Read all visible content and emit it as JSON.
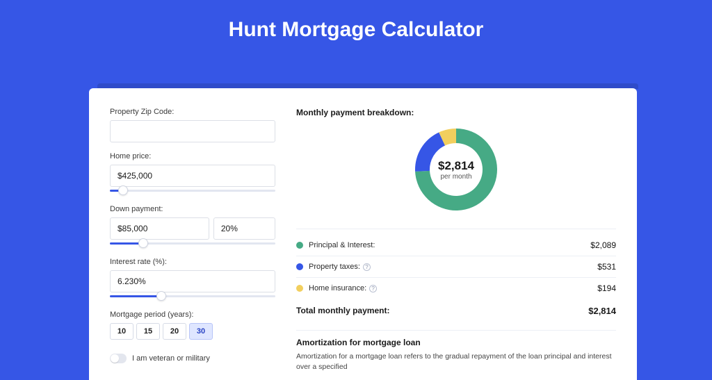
{
  "page": {
    "title": "Hunt Mortgage Calculator"
  },
  "form": {
    "zip": {
      "label": "Property Zip Code:",
      "value": ""
    },
    "homePrice": {
      "label": "Home price:",
      "value": "$425,000",
      "sliderPct": 8
    },
    "downPayment": {
      "label": "Down payment:",
      "valueAmount": "$85,000",
      "valuePct": "20%",
      "sliderPct": 20
    },
    "interestRate": {
      "label": "Interest rate (%):",
      "value": "6.230%",
      "sliderPct": 31
    },
    "mortgagePeriod": {
      "label": "Mortgage period (years):",
      "options": [
        {
          "label": "10",
          "active": false
        },
        {
          "label": "15",
          "active": false
        },
        {
          "label": "20",
          "active": false
        },
        {
          "label": "30",
          "active": true
        }
      ]
    },
    "veteran": {
      "label": "I am veteran or military",
      "enabled": false
    }
  },
  "breakdown": {
    "title": "Monthly payment breakdown:",
    "center": {
      "amount": "$2,814",
      "per": "per month"
    },
    "items": [
      {
        "label": "Principal & Interest:",
        "value": "$2,089",
        "color": "#46aa85",
        "numeric": 2089,
        "help": false
      },
      {
        "label": "Property taxes:",
        "value": "$531",
        "color": "#3656e6",
        "numeric": 531,
        "help": true
      },
      {
        "label": "Home insurance:",
        "value": "$194",
        "color": "#f2cf5e",
        "numeric": 194,
        "help": true
      }
    ],
    "total": {
      "label": "Total monthly payment:",
      "value": "$2,814"
    }
  },
  "amortization": {
    "title": "Amortization for mortgage loan",
    "body": "Amortization for a mortgage loan refers to the gradual repayment of the loan principal and interest over a specified"
  },
  "chart_data": {
    "type": "pie",
    "title": "Monthly payment breakdown",
    "series": [
      {
        "name": "Principal & Interest",
        "value": 2089,
        "color": "#46aa85"
      },
      {
        "name": "Property taxes",
        "value": 531,
        "color": "#3656e6"
      },
      {
        "name": "Home insurance",
        "value": 194,
        "color": "#f2cf5e"
      }
    ],
    "center_label": "$2,814 per month",
    "total": 2814
  }
}
